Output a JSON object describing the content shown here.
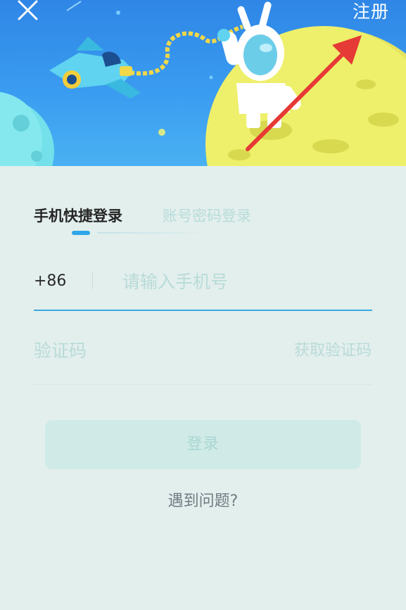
{
  "header": {
    "close_icon": "close-icon",
    "register_label": "注册"
  },
  "tabs": [
    {
      "label": "手机快捷登录",
      "active": true
    },
    {
      "label": "账号密码登录",
      "active": false
    }
  ],
  "phone": {
    "country_code": "+86",
    "placeholder": "请输入手机号",
    "value": ""
  },
  "code": {
    "placeholder": "验证码",
    "value": "",
    "get_code_label": "获取验证码"
  },
  "login_button_label": "登录",
  "help_label": "遇到问题?",
  "colors": {
    "accent": "#3aaae3",
    "annotation_arrow": "#e53a35",
    "banner_blue": "#2f86e6",
    "background": "#e3efed"
  }
}
